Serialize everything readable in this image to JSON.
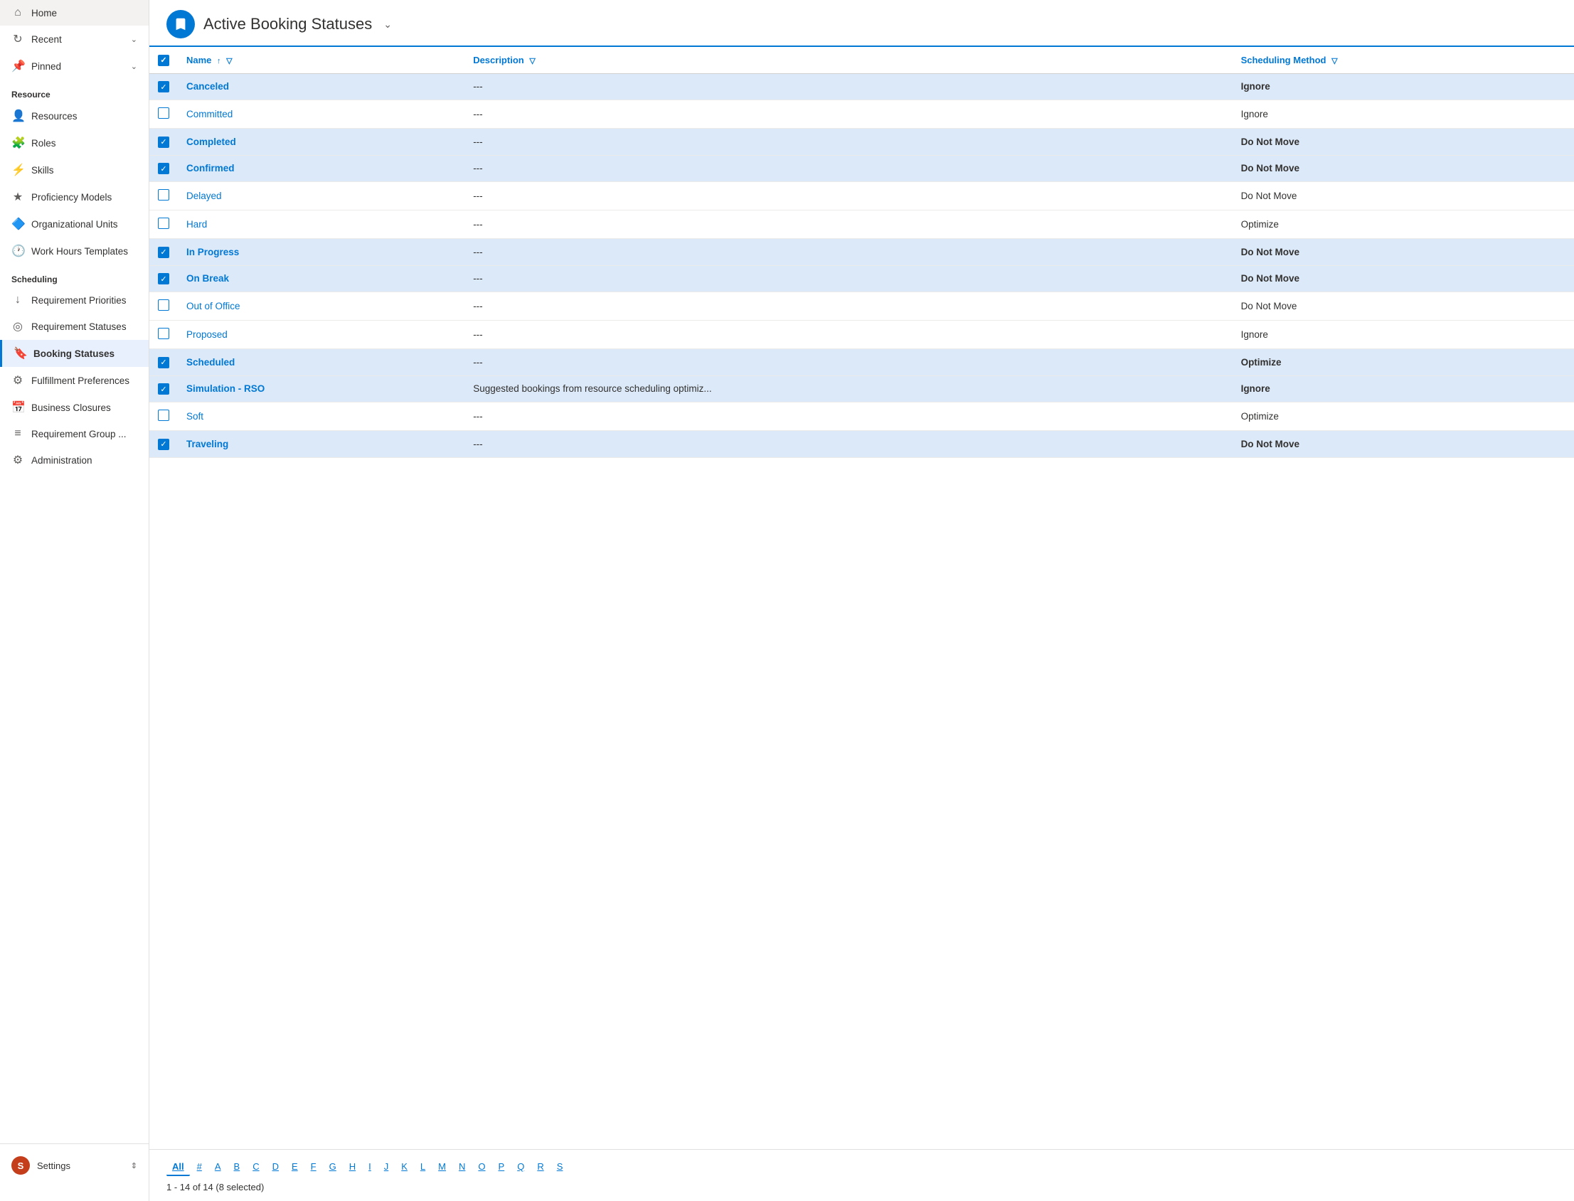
{
  "sidebar": {
    "nav_top": [
      {
        "id": "home",
        "label": "Home",
        "icon": "⌂"
      },
      {
        "id": "recent",
        "label": "Recent",
        "icon": "↻",
        "hasChevron": true
      },
      {
        "id": "pinned",
        "label": "Pinned",
        "icon": "📌",
        "hasChevron": true
      }
    ],
    "sections": [
      {
        "label": "Resource",
        "items": [
          {
            "id": "resources",
            "label": "Resources",
            "icon": "👤"
          },
          {
            "id": "roles",
            "label": "Roles",
            "icon": "🧩"
          },
          {
            "id": "skills",
            "label": "Skills",
            "icon": "⚡"
          },
          {
            "id": "proficiency-models",
            "label": "Proficiency Models",
            "icon": "★"
          },
          {
            "id": "organizational-units",
            "label": "Organizational Units",
            "icon": "🔷"
          },
          {
            "id": "work-hours-templates",
            "label": "Work Hours Templates",
            "icon": "🕐"
          }
        ]
      },
      {
        "label": "Scheduling",
        "items": [
          {
            "id": "requirement-priorities",
            "label": "Requirement Priorities",
            "icon": "↓"
          },
          {
            "id": "requirement-statuses",
            "label": "Requirement Statuses",
            "icon": "◎"
          },
          {
            "id": "booking-statuses",
            "label": "Booking Statuses",
            "icon": "🔖",
            "active": true
          },
          {
            "id": "fulfillment-preferences",
            "label": "Fulfillment Preferences",
            "icon": "⚙"
          },
          {
            "id": "business-closures",
            "label": "Business Closures",
            "icon": "📅"
          },
          {
            "id": "requirement-group",
            "label": "Requirement Group ...",
            "icon": "≡"
          },
          {
            "id": "administration",
            "label": "Administration",
            "icon": "⚙"
          }
        ]
      }
    ],
    "bottom": {
      "label": "Settings",
      "avatar_letter": "S"
    }
  },
  "header": {
    "icon": "🔖",
    "title": "Active Booking Statuses",
    "chevron": "⌄"
  },
  "table": {
    "columns": [
      {
        "id": "checkbox",
        "label": ""
      },
      {
        "id": "name",
        "label": "Name",
        "sortable": true,
        "filterable": true
      },
      {
        "id": "description",
        "label": "Description",
        "filterable": true
      },
      {
        "id": "scheduling-method",
        "label": "Scheduling Method",
        "filterable": true
      }
    ],
    "rows": [
      {
        "id": 1,
        "name": "Canceled",
        "description": "---",
        "method": "Ignore",
        "selected": true,
        "bold": true
      },
      {
        "id": 2,
        "name": "Committed",
        "description": "---",
        "method": "Ignore",
        "selected": false,
        "bold": false
      },
      {
        "id": 3,
        "name": "Completed",
        "description": "---",
        "method": "Do Not Move",
        "selected": true,
        "bold": true
      },
      {
        "id": 4,
        "name": "Confirmed",
        "description": "---",
        "method": "Do Not Move",
        "selected": true,
        "bold": true
      },
      {
        "id": 5,
        "name": "Delayed",
        "description": "---",
        "method": "Do Not Move",
        "selected": false,
        "bold": false
      },
      {
        "id": 6,
        "name": "Hard",
        "description": "---",
        "method": "Optimize",
        "selected": false,
        "bold": false
      },
      {
        "id": 7,
        "name": "In Progress",
        "description": "---",
        "method": "Do Not Move",
        "selected": true,
        "bold": true
      },
      {
        "id": 8,
        "name": "On Break",
        "description": "---",
        "method": "Do Not Move",
        "selected": true,
        "bold": true
      },
      {
        "id": 9,
        "name": "Out of Office",
        "description": "---",
        "method": "Do Not Move",
        "selected": false,
        "bold": false
      },
      {
        "id": 10,
        "name": "Proposed",
        "description": "---",
        "method": "Ignore",
        "selected": false,
        "bold": false
      },
      {
        "id": 11,
        "name": "Scheduled",
        "description": "---",
        "method": "Optimize",
        "selected": true,
        "bold": true
      },
      {
        "id": 12,
        "name": "Simulation - RSO",
        "description": "Suggested bookings from resource scheduling optimiz...",
        "method": "Ignore",
        "selected": true,
        "bold": true
      },
      {
        "id": 13,
        "name": "Soft",
        "description": "---",
        "method": "Optimize",
        "selected": false,
        "bold": false
      },
      {
        "id": 14,
        "name": "Traveling",
        "description": "---",
        "method": "Do Not Move",
        "selected": true,
        "bold": true
      }
    ]
  },
  "pagination": {
    "alpha_bar": [
      "All",
      "#",
      "A",
      "B",
      "C",
      "D",
      "E",
      "F",
      "G",
      "H",
      "I",
      "J",
      "K",
      "L",
      "M",
      "N",
      "O",
      "P",
      "Q",
      "R",
      "S"
    ],
    "active_alpha": "All",
    "page_info": "1 - 14 of 14 (8 selected)"
  }
}
